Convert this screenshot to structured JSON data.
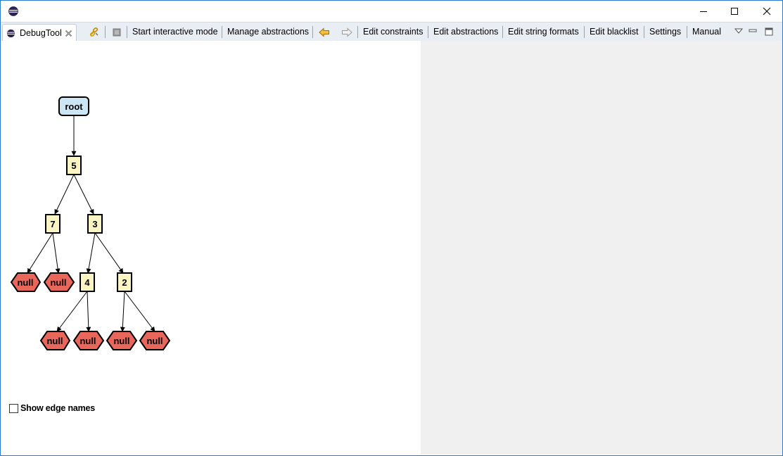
{
  "window": {
    "controls": [
      "minimize-icon",
      "maximize-icon",
      "close-icon"
    ]
  },
  "tab": {
    "label": "DebugTool",
    "icon": "eclipse-icon"
  },
  "toolbar": {
    "icons": [
      "link-icon",
      "stop-icon",
      "back-arrow-icon",
      "forward-arrow-icon"
    ],
    "start_interactive_mode": "Start interactive mode",
    "manage_abstractions": "Manage abstractions",
    "edit_constraints": "Edit constraints",
    "edit_abstractions": "Edit abstractions",
    "edit_string_formats": "Edit string formats",
    "edit_blacklist": "Edit blacklist",
    "settings": "Settings",
    "manual": "Manual"
  },
  "graph": {
    "root_label": "root",
    "nodes": {
      "n5": "5",
      "n7": "7",
      "n3": "3",
      "n4": "4",
      "n2": "2",
      "null": "null"
    },
    "colors": {
      "root_fill": "#cce6f4",
      "value_fill": "#fbf5c3",
      "null_fill": "#e8675a",
      "stroke": "#000000"
    }
  },
  "options": {
    "show_edge_names_label": "Show edge names",
    "show_edge_names_checked": false
  }
}
